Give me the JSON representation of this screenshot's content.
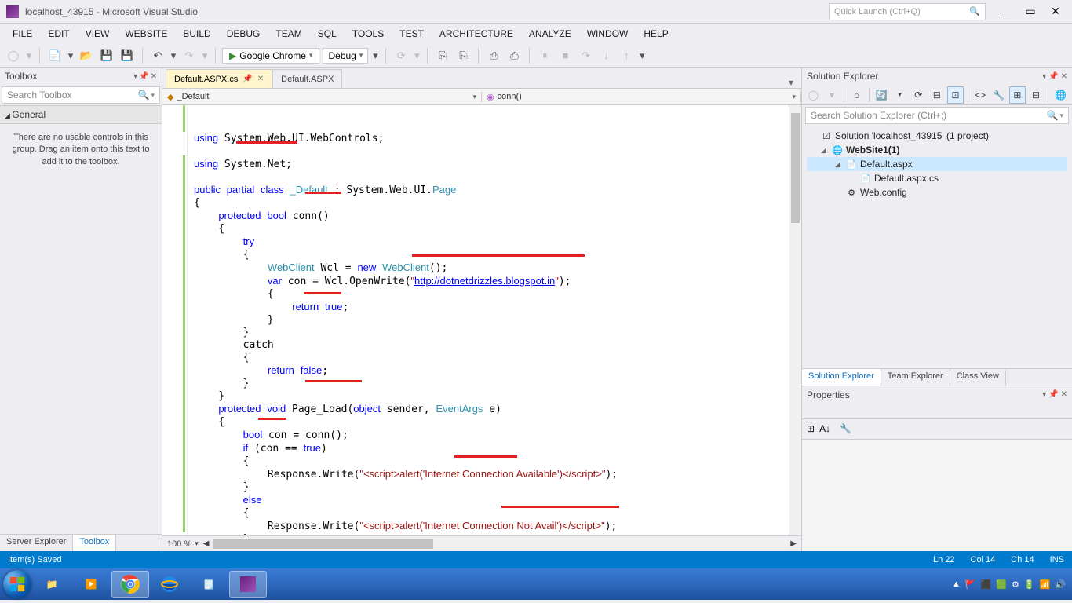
{
  "titlebar": {
    "title": "localhost_43915 - Microsoft Visual Studio",
    "quick_launch_placeholder": "Quick Launch (Ctrl+Q)"
  },
  "menu": [
    "FILE",
    "EDIT",
    "VIEW",
    "WEBSITE",
    "BUILD",
    "DEBUG",
    "TEAM",
    "SQL",
    "TOOLS",
    "TEST",
    "ARCHITECTURE",
    "ANALYZE",
    "WINDOW",
    "HELP"
  ],
  "toolbar": {
    "browser": "Google Chrome",
    "config": "Debug"
  },
  "toolbox": {
    "title": "Toolbox",
    "search_placeholder": "Search Toolbox",
    "group": "General",
    "empty_text": "There are no usable controls in this group. Drag an item onto this text to add it to the toolbox."
  },
  "left_tabs": {
    "server_explorer": "Server Explorer",
    "toolbox": "Toolbox"
  },
  "doc_tabs": {
    "active": "Default.ASPX.cs",
    "preview": "Default.ASPX"
  },
  "nav": {
    "class": "_Default",
    "member": "conn()"
  },
  "code": {
    "line1": "using System.Web.UI.WebControls;",
    "line2": "",
    "line3": "using System.Net;",
    "line4": "",
    "line5": "public partial class _Default : System.Web.UI.Page",
    "line6": "{",
    "line7": "    protected bool conn()",
    "line8": "    {",
    "line9": "        try",
    "line10": "        {",
    "line11": "            WebClient Wcl = new WebClient();",
    "line12": "            var con = Wcl.OpenWrite(\"http://dotnetdrizzles.blogspot.in\");",
    "line13": "            {",
    "line14": "                return true;",
    "line15": "            }",
    "line16": "        }",
    "line17": "        catch",
    "line18": "        {",
    "line19": "            return false;",
    "line20": "        }",
    "line21": "    }",
    "line22": "    protected void Page_Load(object sender, EventArgs e)",
    "line23": "    {",
    "line24": "        bool con = conn();",
    "line25": "        if (con == true)",
    "line26": "        {",
    "line27": "            Response.Write(\"<script>alert('Internet Connection Available')</script>\");",
    "line28": "        }",
    "line29": "        else",
    "line30": "        {",
    "line31": "            Response.Write(\"<script>alert('Internet Connection Not Avail')</script>\");",
    "line32": "        }",
    "line33": "    }",
    "line34": "}"
  },
  "zoom": "100 %",
  "solution_explorer": {
    "title": "Solution Explorer",
    "search_placeholder": "Search Solution Explorer (Ctrl+;)",
    "root": "Solution 'localhost_43915' (1 project)",
    "project": "WebSite1(1)",
    "file1": "Default.aspx",
    "file2": "Default.aspx.cs",
    "file3": "Web.config"
  },
  "right_tabs": {
    "se": "Solution Explorer",
    "te": "Team Explorer",
    "cv": "Class View"
  },
  "properties": {
    "title": "Properties"
  },
  "status": {
    "msg": "Item(s) Saved",
    "ln": "Ln 22",
    "col": "Col 14",
    "ch": "Ch 14",
    "ins": "INS"
  }
}
